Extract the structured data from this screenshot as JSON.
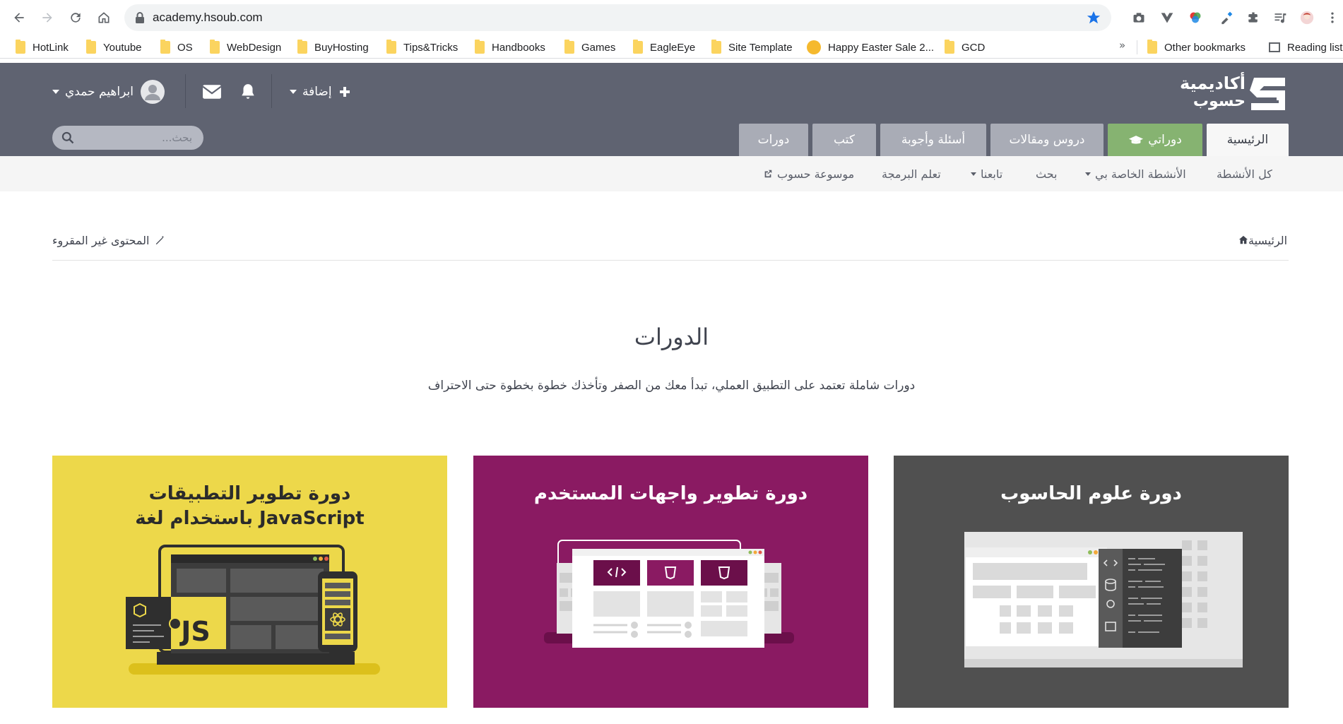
{
  "browser": {
    "url": "academy.hsoub.com",
    "bookmarks": [
      {
        "label": "HotLink",
        "type": "folder"
      },
      {
        "label": "Youtube",
        "type": "folder"
      },
      {
        "label": "OS",
        "type": "folder"
      },
      {
        "label": "WebDesign",
        "type": "folder"
      },
      {
        "label": "BuyHosting",
        "type": "folder"
      },
      {
        "label": "Tips&Tricks",
        "type": "folder"
      },
      {
        "label": "Handbooks",
        "type": "folder"
      },
      {
        "label": "Games",
        "type": "folder"
      },
      {
        "label": "EagleEye",
        "type": "folder"
      },
      {
        "label": "Site Template",
        "type": "folder"
      },
      {
        "label": "Happy Easter Sale 2...",
        "type": "page"
      },
      {
        "label": "GCD",
        "type": "folder"
      }
    ],
    "overflow": "»",
    "other_bookmarks": "Other bookmarks",
    "reading_list": "Reading list"
  },
  "header": {
    "logo_line1": "أكاديمية",
    "logo_line2": "حسوب",
    "user_name": "ابراهيم حمدي",
    "add_label": "إضافة",
    "search_placeholder": "بحث...",
    "tabs": [
      "الرئيسية",
      "دوراتي",
      "دروس ومقالات",
      "أسئلة وأجوبة",
      "كتب",
      "دورات"
    ],
    "active_tab": "الرئيسية",
    "accent_tab": "دوراتي"
  },
  "subnav": {
    "items": [
      "كل الأنشطة",
      "الأنشطة الخاصة بي",
      "بحث",
      "تابعنا",
      "تعلم البرمجة",
      "موسوعة حسوب"
    ]
  },
  "breadcrumb": {
    "home": "الرئيسية",
    "unread": "المحتوى غير المقروء"
  },
  "main": {
    "title": "الدورات",
    "subtitle": "دورات شاملة تعتمد على التطبيق العملي، تبدأ معك من الصفر وتأخذك خطوة بخطوة حتى الاحتراف"
  },
  "cards": [
    {
      "line1": "دورة علوم الحاسوب",
      "line2": "",
      "bg": "#505050"
    },
    {
      "line1": "دورة تطوير واجهات المستخدم",
      "line2": "",
      "bg": "#8a1a62"
    },
    {
      "line1": "دورة تطوير التطبيقات",
      "line2": "باستخدام لغة JavaScript",
      "bg": "#edd84a",
      "badge": "JS"
    }
  ],
  "colors": {
    "header_bg": "#5f6371",
    "tab_bg": "#a9acb6",
    "tab_accent": "#86b371",
    "subnav_bg": "#f5f5f5"
  }
}
